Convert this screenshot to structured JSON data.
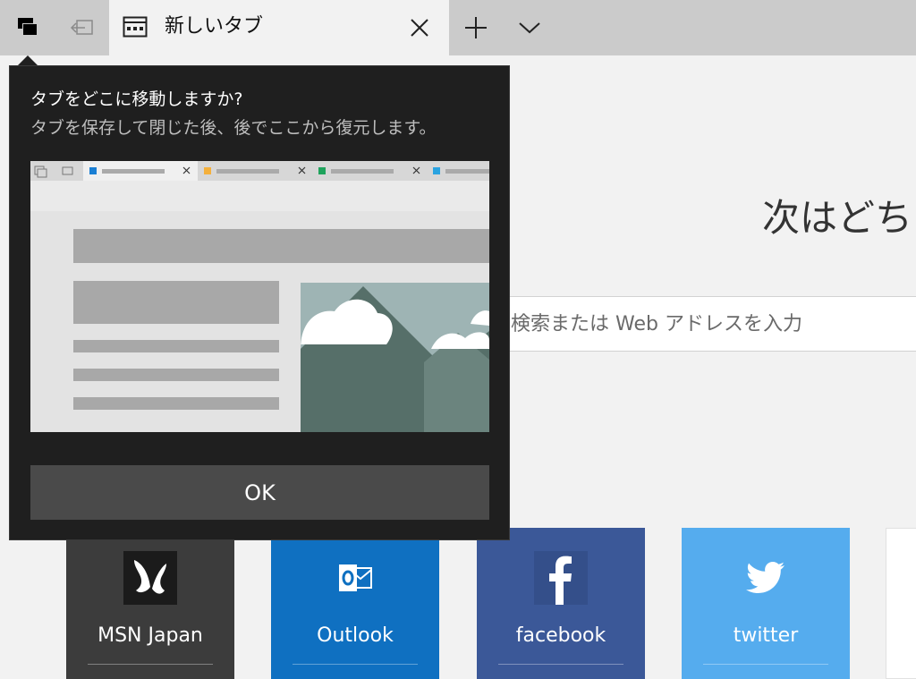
{
  "tabbar": {
    "tab": {
      "title": "新しいタブ"
    }
  },
  "page": {
    "heading": "次はどちら",
    "search": {
      "placeholder": "検索または Web アドレスを入力"
    },
    "tiles": [
      {
        "label": "MSN Japan",
        "color": "#3c3c3c"
      },
      {
        "label": "Outlook",
        "color": "#0f70c1"
      },
      {
        "label": "facebook",
        "color": "#3b5898"
      },
      {
        "label": "twitter",
        "color": "#55acee"
      }
    ]
  },
  "popup": {
    "title": "タブをどこに移動しますか?",
    "description": "タブを保存して閉じた後、後でここから復元します。",
    "ok_label": "OK"
  },
  "colors": {
    "tabbar_bg": "#cbcbcb",
    "page_bg": "#f2f2f2",
    "popup_bg": "#1f1f1f",
    "ok_button": "#4a4a4a"
  }
}
